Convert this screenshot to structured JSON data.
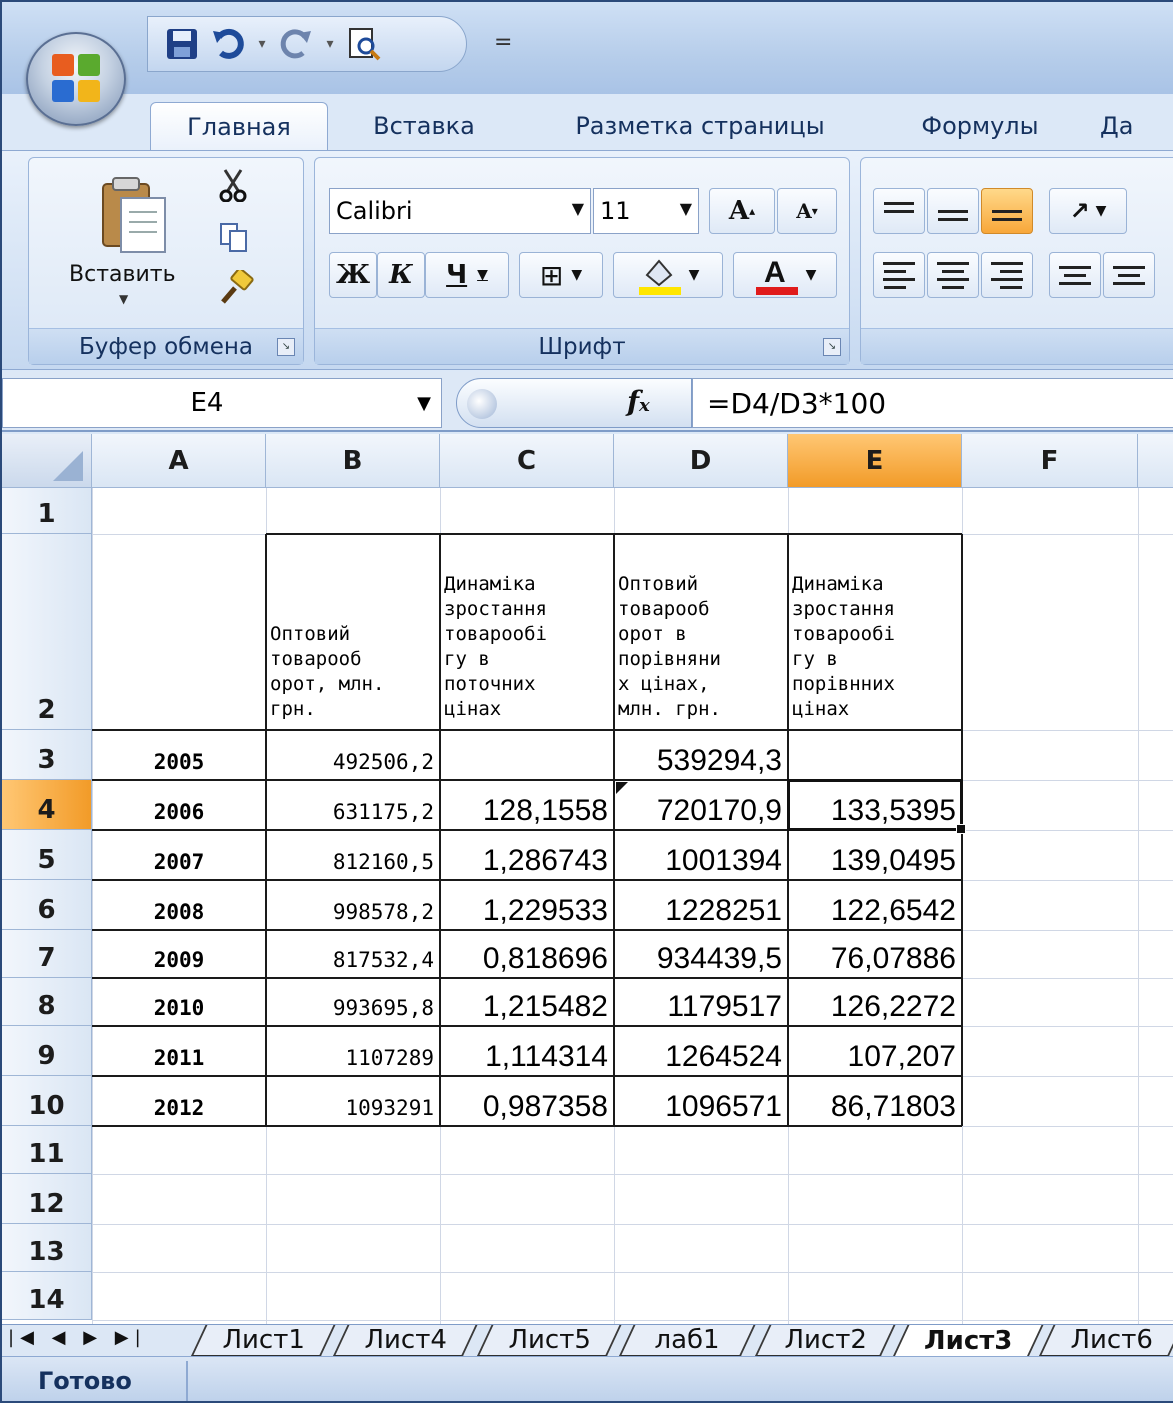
{
  "qat": {
    "more_label": "="
  },
  "tabs": [
    "Главная",
    "Вставка",
    "Разметка страницы",
    "Формулы",
    "Да"
  ],
  "ribbon": {
    "clipboard": {
      "paste_label": "Вставить",
      "group_label": "Буфер обмена"
    },
    "font": {
      "font_name": "Calibri",
      "font_size": "11",
      "bold": "Ж",
      "italic": "К",
      "underline": "Ч",
      "group_label": "Шрифт"
    }
  },
  "formula_bar": {
    "name_box": "E4",
    "fx": "fx",
    "formula": "=D4/D3*100"
  },
  "grid": {
    "columns": [
      "A",
      "B",
      "C",
      "D",
      "E",
      "F"
    ],
    "rows": [
      "1",
      "2",
      "3",
      "4",
      "5",
      "6",
      "7",
      "8",
      "9",
      "10",
      "11",
      "12",
      "13",
      "14"
    ],
    "selected_cell": "E4",
    "headers": {
      "B": "Оптовий\nтоварооб\nорот, млн.\nгрн.",
      "C": "Динаміка\nзростання\nтоварообі\nгу в\nпоточних\nцінах",
      "D": "Оптовий\nтоварооб\nорот в\nпорівняни\nх цінах,\nмлн. грн.",
      "E": "Динаміка\nзростання\nтоварообі\nгу в\nпорівнних\nцінах"
    },
    "data_rows": [
      {
        "A": "2005",
        "B": "492506,2",
        "C": "",
        "D": "539294,3",
        "E": ""
      },
      {
        "A": "2006",
        "B": "631175,2",
        "C": "128,1558",
        "D": "720170,9",
        "E": "133,5395"
      },
      {
        "A": "2007",
        "B": "812160,5",
        "C": "1,286743",
        "D": "1001394",
        "E": "139,0495"
      },
      {
        "A": "2008",
        "B": "998578,2",
        "C": "1,229533",
        "D": "1228251",
        "E": "122,6542"
      },
      {
        "A": "2009",
        "B": "817532,4",
        "C": "0,818696",
        "D": "934439,5",
        "E": "76,07886"
      },
      {
        "A": "2010",
        "B": "993695,8",
        "C": "1,215482",
        "D": "1179517",
        "E": "126,2272"
      },
      {
        "A": "2011",
        "B": "1107289",
        "C": "1,114314",
        "D": "1264524",
        "E": "107,207"
      },
      {
        "A": "2012",
        "B": "1093291",
        "C": "0,987358",
        "D": "1096571",
        "E": "86,71803"
      }
    ]
  },
  "sheet_tabs": [
    "Лист1",
    "Лист4",
    "Лист5",
    "лаб1",
    "Лист2",
    "Лист3",
    "Лист6"
  ],
  "active_sheet": "Лист3",
  "status": {
    "text": "Готово"
  },
  "colors": {
    "accent": "#f29b28",
    "ribbon": "#dce8f7",
    "border": "#1a1a1a"
  }
}
